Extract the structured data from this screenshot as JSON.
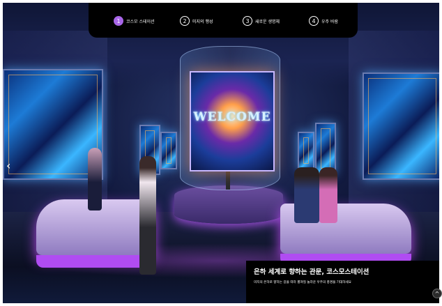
{
  "nav": {
    "items": [
      {
        "number": "1",
        "label": "코스모 스테이션",
        "active": true
      },
      {
        "number": "2",
        "label": "미지의 행성",
        "active": false
      },
      {
        "number": "3",
        "label": "새로운 생명체",
        "active": false
      },
      {
        "number": "4",
        "label": "우주 바람",
        "active": false
      }
    ]
  },
  "hologram": {
    "text": "WELCOME"
  },
  "caption": {
    "title": "은하 세계로 향하는 관문, 코스모스테이션",
    "description": "미지의 은하로 향하는 길을 따라 펼쳐질 놀라운 우주의 풍경을 기대하세요"
  },
  "icons": {
    "left_arrow": "chevron-left-icon",
    "scroll_top": "chevron-up-icon"
  },
  "colors": {
    "accent": "#a866e8",
    "nav_background": "#000000"
  }
}
